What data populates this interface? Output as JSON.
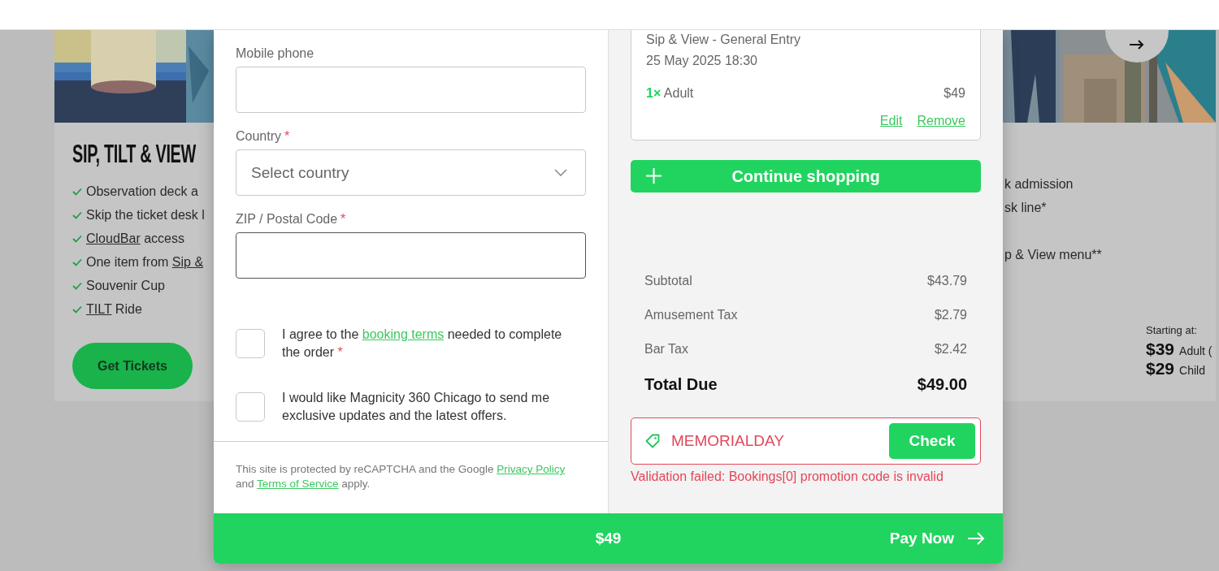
{
  "left_card": {
    "title": "SIP, TILT & VIEW",
    "features": [
      {
        "before": "Observation deck a"
      },
      {
        "before": "Skip the ticket desk l"
      },
      {
        "link": "CloudBar",
        "after": " access"
      },
      {
        "before": "One item from ",
        "link": "Sip &"
      },
      {
        "before": "Souvenir Cup"
      },
      {
        "link": "TILT",
        "after": " Ride"
      }
    ],
    "button": "Get Tickets"
  },
  "right_card": {
    "features": [
      "k admission",
      "sk line*",
      "p & View menu**"
    ],
    "price_caption": "Starting at:",
    "prices": [
      {
        "amount": "$39",
        "unit": "Adult ("
      },
      {
        "amount": "$29",
        "unit": "Child"
      }
    ]
  },
  "form": {
    "fields": [
      {
        "label": "Mobile phone",
        "kind": "text",
        "focused": false
      },
      {
        "label": "Country",
        "required_mark": "*",
        "kind": "select",
        "placeholder": "Select country",
        "focused": false
      },
      {
        "label": "ZIP / Postal Code",
        "required_mark": "*",
        "kind": "text",
        "focused": true
      }
    ],
    "consents": [
      {
        "before": "I agree to the ",
        "link": "booking terms",
        "after": " needed to complete the order",
        "required_mark": "*",
        "checked": false
      },
      {
        "before": "I would like Magnicity 360 Chicago to send me exclusive updates and the latest offers.",
        "checked": false
      }
    ],
    "recaptcha": {
      "text1": "This site is protected by reCAPTCHA and the Google ",
      "link1": "Privacy Policy",
      "text2": " and ",
      "link2": "Terms of Service",
      "text3": " apply."
    }
  },
  "order": {
    "item_title": "Sip & View - General Entry",
    "date": "25 May 2025 18:30",
    "quantity": "1×",
    "ticket": "Adult",
    "price": "$49",
    "actions": [
      "Edit",
      "Remove"
    ],
    "continue_button": "Continue shopping",
    "summary": [
      {
        "label": "Subtotal",
        "value": "$43.79",
        "kind": "line"
      },
      {
        "label": "Amusement Tax",
        "value": "$2.79",
        "kind": "line"
      },
      {
        "label": "Bar Tax",
        "value": "$2.42",
        "kind": "line"
      },
      {
        "label": "Total Due",
        "value": "$49.00",
        "kind": "total"
      }
    ],
    "promo": {
      "value": "MEMORIALDAY",
      "invalid": true,
      "button": "Check",
      "error": "Validation failed: Bookings[0] promotion code is invalid"
    }
  },
  "pay_bar": {
    "amount": "$49",
    "button": "Pay Now"
  }
}
